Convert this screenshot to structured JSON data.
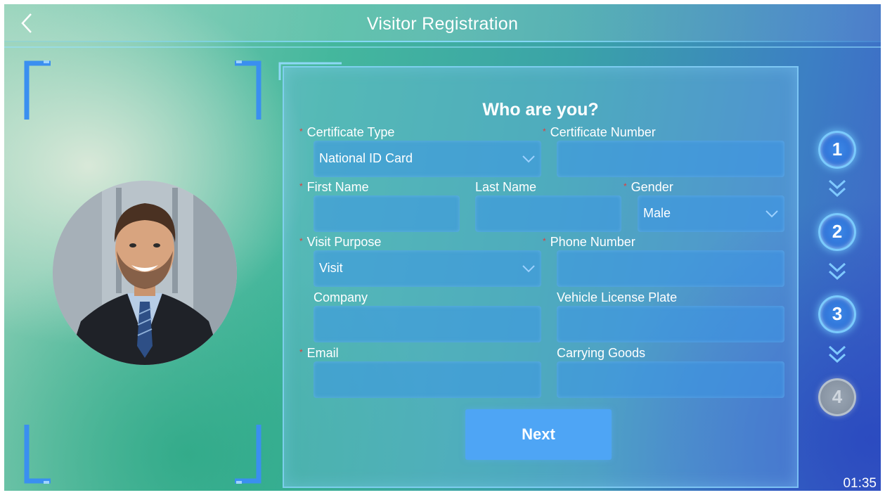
{
  "header": {
    "title": "Visitor Registration"
  },
  "form": {
    "title": "Who are you?",
    "fields": {
      "certificate_type": {
        "label": "Certificate Type",
        "value": "National ID Card"
      },
      "certificate_number": {
        "label": "Certificate Number",
        "value": ""
      },
      "first_name": {
        "label": "First Name",
        "value": ""
      },
      "last_name": {
        "label": "Last Name",
        "value": ""
      },
      "gender": {
        "label": "Gender",
        "value": "Male"
      },
      "visit_purpose": {
        "label": "Visit Purpose",
        "value": "Visit"
      },
      "phone_number": {
        "label": "Phone Number",
        "value": ""
      },
      "company": {
        "label": "Company",
        "value": ""
      },
      "vehicle_license_plate": {
        "label": "Vehicle License Plate",
        "value": ""
      },
      "email": {
        "label": "Email",
        "value": ""
      },
      "carrying_goods": {
        "label": "Carrying Goods",
        "value": ""
      }
    },
    "required_marker": "*",
    "next_label": "Next"
  },
  "steps": [
    {
      "label": "1",
      "state": "active"
    },
    {
      "label": "2",
      "state": "active"
    },
    {
      "label": "3",
      "state": "active"
    },
    {
      "label": "4",
      "state": "inactive"
    }
  ],
  "timer": "01:35",
  "colors": {
    "accent": "#4ea5f5",
    "required": "#e23b3b",
    "frame": "#3a8ff0"
  },
  "icons": {
    "back": "chevron-left-icon",
    "select": "chevron-down-icon",
    "step_arrow": "double-chevron-down-icon"
  }
}
